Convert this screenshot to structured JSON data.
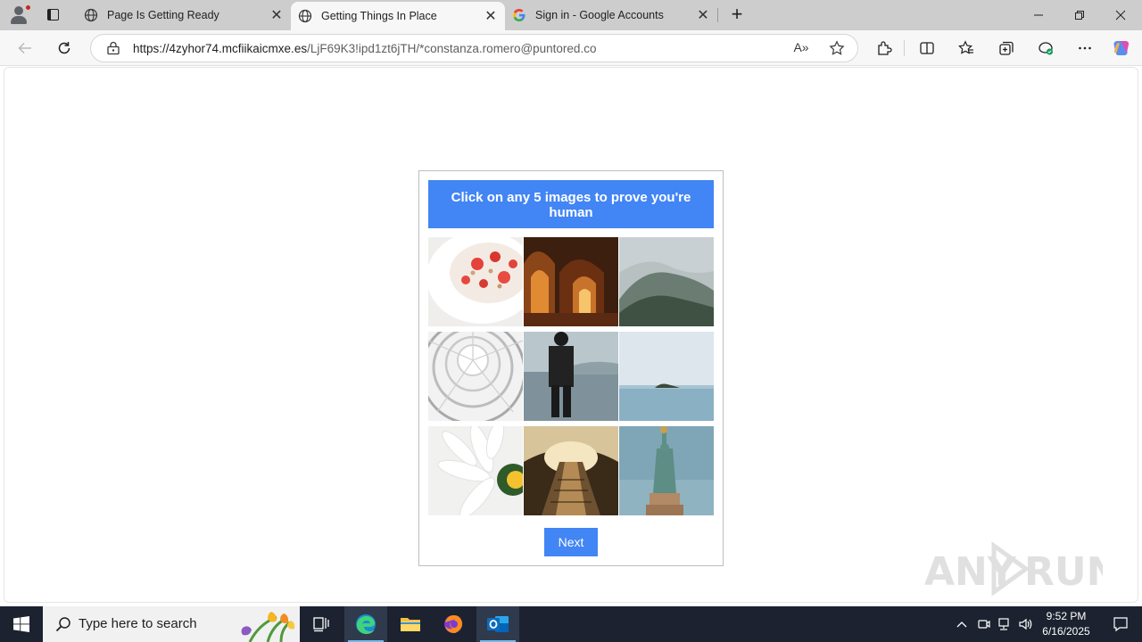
{
  "browser": {
    "tabs": [
      {
        "title": "Page Is Getting Ready",
        "active": false,
        "icon": "globe-icon"
      },
      {
        "title": "Getting Things In Place",
        "active": true,
        "icon": "globe-icon"
      },
      {
        "title": "Sign in - Google Accounts",
        "active": false,
        "icon": "google-g-icon"
      }
    ],
    "close_glyph": "✕",
    "new_tab_glyph": "+",
    "url_host": "https://4zyhor74.mcfiikaicmxe.es",
    "url_path": "/LjF69K3!ipd1zt6jTH/*constanza.romero@puntored.co",
    "read_aloud_glyph": "A»",
    "accent_color": "#4285f4"
  },
  "captcha": {
    "header": "Click on any 5 images to prove you're human",
    "next_label": "Next",
    "images": [
      "bowl-of-yogurt-with-strawberries",
      "arched-corridor",
      "misty-mountain",
      "spiral-dome-ceiling",
      "person-looking-at-lake",
      "small-island-in-sea",
      "white-daisy-flower",
      "subway-escalator-tunnel",
      "statue-of-liberty"
    ]
  },
  "watermark": {
    "text": "ANY RUN"
  },
  "taskbar": {
    "search_placeholder": "Type here to search",
    "time": "9:52 PM",
    "date": "6/16/2025"
  }
}
